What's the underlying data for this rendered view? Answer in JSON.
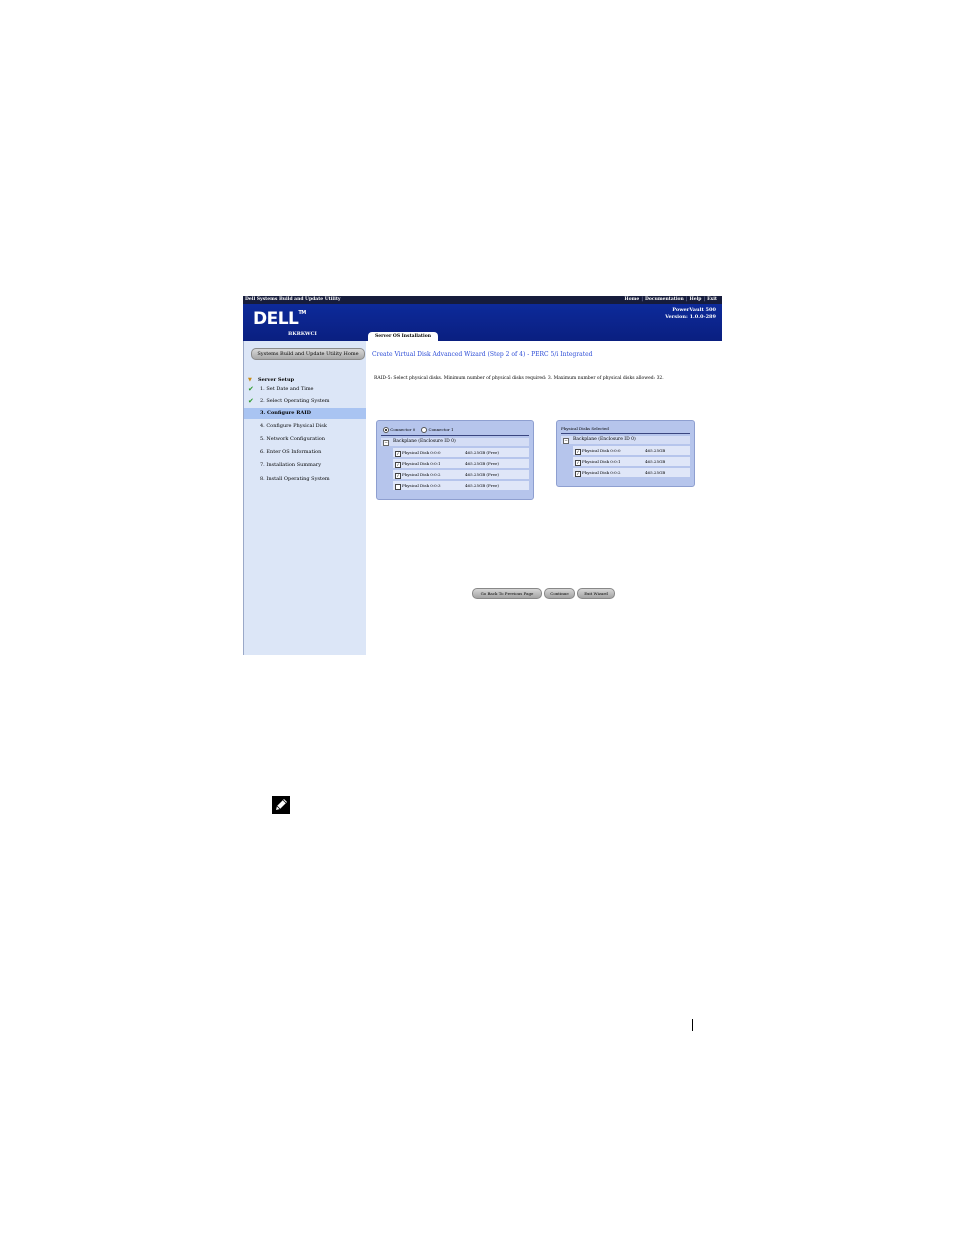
{
  "topbar": {
    "app_title": "Dell Systems Build and Update Utility",
    "nav": [
      "Home",
      "Documentation",
      "Help",
      "Exit"
    ]
  },
  "header": {
    "logo": "DELL",
    "logo_tm": "TM",
    "service_tag": "BKRKWCI",
    "product": "PowerVault 500",
    "version": "Version: 1.0.0-289",
    "tab": "Server OS Installation"
  },
  "sidebar": {
    "home_button": "Systems Build and Update Utility Home",
    "section": "Server Setup",
    "steps": [
      {
        "label": "1. Set Date and Time",
        "done": true
      },
      {
        "label": "2. Select Operating System",
        "done": true
      },
      {
        "label": "3. Configure RAID",
        "active": true
      },
      {
        "label": "4. Configure Physical Disk"
      },
      {
        "label": "5. Network Configuration"
      },
      {
        "label": "6. Enter OS Information"
      },
      {
        "label": "7. Installation Summary"
      },
      {
        "label": "8. Install Operating System"
      }
    ]
  },
  "main": {
    "title": "Create Virtual Disk Advanced Wizard (Step 2 of 4) - PERC 5/i Integrated",
    "raid_desc": "RAID-5: Select physical disks. Minimum number of physical disks required: 3. Maximum number of physical disks allowed: 32.",
    "connectors": [
      "Connector 0",
      "Connector 1"
    ],
    "left_panel": {
      "backplane": "Backplane (Enclosure ID 0)",
      "disks": [
        {
          "name": "Physical Disk 0:0:0",
          "size": "465.25GB (Free)",
          "checked": true
        },
        {
          "name": "Physical Disk 0:0:1",
          "size": "465.25GB (Free)",
          "checked": true
        },
        {
          "name": "Physical Disk 0:0:2",
          "size": "465.25GB (Free)",
          "checked": true
        },
        {
          "name": "Physical Disk 0:0:3",
          "size": "465.25GB (Free)",
          "checked": false
        }
      ]
    },
    "right_panel": {
      "title": "Physical Disks Selected",
      "backplane": "Backplane (Enclosure ID 0)",
      "disks": [
        {
          "name": "Physical Disk 0:0:0",
          "size": "465.25GB",
          "checked": true
        },
        {
          "name": "Physical Disk 0:0:1",
          "size": "465.25GB",
          "checked": true
        },
        {
          "name": "Physical Disk 0:0:2",
          "size": "465.25GB",
          "checked": true
        }
      ]
    },
    "buttons": {
      "back": "Go Back To Previous Page",
      "continue": "Continue",
      "exit": "Exit Wizard"
    }
  },
  "colors": {
    "header_blue": "#0a1f80",
    "sidebar_bg": "#dce6f7",
    "active_step": "#a9c4f2",
    "title_blue": "#2b4bd6",
    "panel_bg": "#b6c5ec"
  },
  "icons": [
    "check-icon",
    "arrow-down-icon",
    "radio-icon",
    "checkbox-icon",
    "collapse-icon",
    "note-pencil-icon"
  ]
}
